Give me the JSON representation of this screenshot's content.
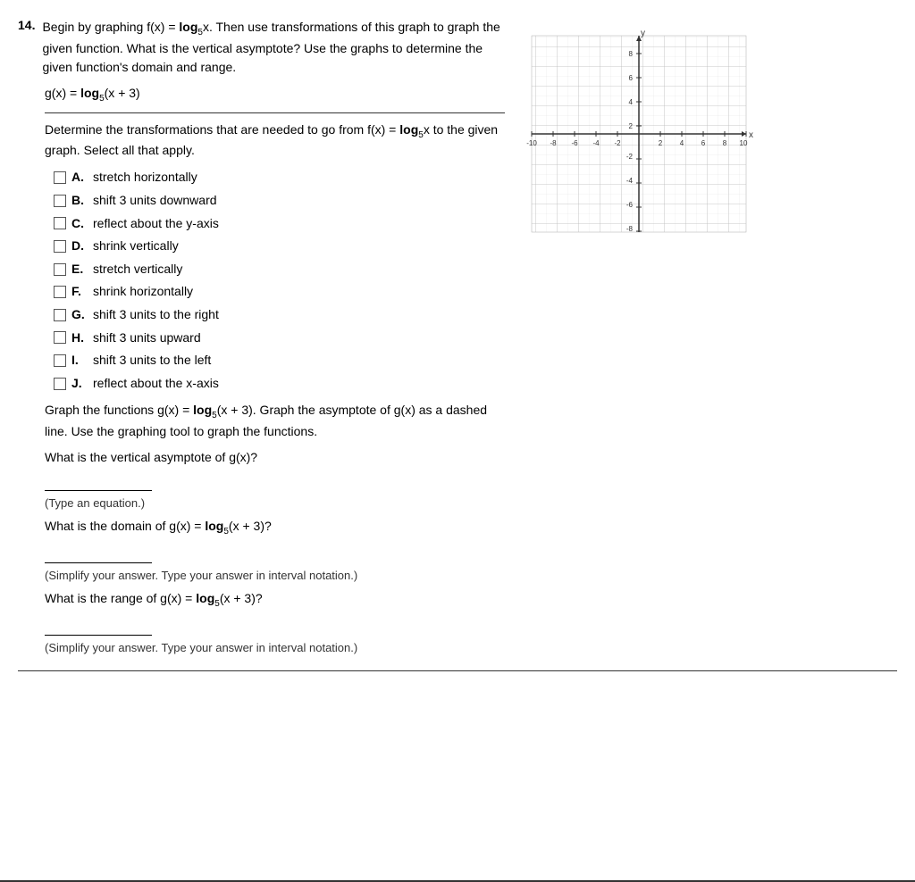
{
  "question": {
    "number": "14.",
    "intro": "Begin by graphing f(x) = log",
    "intro_sub": "5",
    "intro_rest": "x. Then use transformations of this graph to graph the given function. What is the vertical asymptote? Use the graphs to determine the given function's domain and range.",
    "given_function_label": "g(x) = log",
    "given_function_sub": "5",
    "given_function_rest": "(x + 3)",
    "transform_prompt": "Determine the transformations that are needed to go from f(x) = log",
    "transform_sub": "5",
    "transform_rest": "x to the given graph. Select all that apply.",
    "options": [
      {
        "letter": "A.",
        "text": "stretch horizontally"
      },
      {
        "letter": "B.",
        "text": "shift 3 units downward"
      },
      {
        "letter": "C.",
        "text": "reflect about the y-axis"
      },
      {
        "letter": "D.",
        "text": "shrink vertically"
      },
      {
        "letter": "E.",
        "text": "stretch vertically"
      },
      {
        "letter": "F.",
        "text": "shrink horizontally"
      },
      {
        "letter": "G.",
        "text": "shift 3 units to the right"
      },
      {
        "letter": "H.",
        "text": "shift 3 units upward"
      },
      {
        "letter": "I.",
        "text": "shift 3 units to the left"
      },
      {
        "letter": "J.",
        "text": "reflect about the x-axis"
      }
    ],
    "graph_instruction_1": "Graph the functions g(x) = log",
    "graph_instruction_sub": "5",
    "graph_instruction_2": "(x + 3).  Graph the asymptote of g(x) as a dashed line. Use the graphing tool to graph the functions.",
    "asymptote_question": "What is the vertical asymptote of g(x)?",
    "asymptote_hint": "(Type an equation.)",
    "domain_question_1": "What is the domain of g(x) = log",
    "domain_question_sub": "5",
    "domain_question_2": "(x + 3)?",
    "domain_hint": "(Simplify your answer. Type your answer in interval notation.)",
    "range_question_1": "What is the range of g(x) = log",
    "range_question_sub": "5",
    "range_question_2": "(x + 3)?",
    "range_hint": "(Simplify your answer. Type your answer in interval notation.)"
  },
  "graph": {
    "x_min": -10,
    "x_max": 10,
    "y_min": -8,
    "y_max": 8,
    "x_label": "x",
    "y_label": "y",
    "x_ticks": [
      -10,
      -8,
      -6,
      -4,
      -2,
      2,
      4,
      6,
      8,
      10
    ],
    "y_ticks": [
      -8,
      -6,
      -4,
      -2,
      2,
      4,
      6,
      8
    ]
  }
}
